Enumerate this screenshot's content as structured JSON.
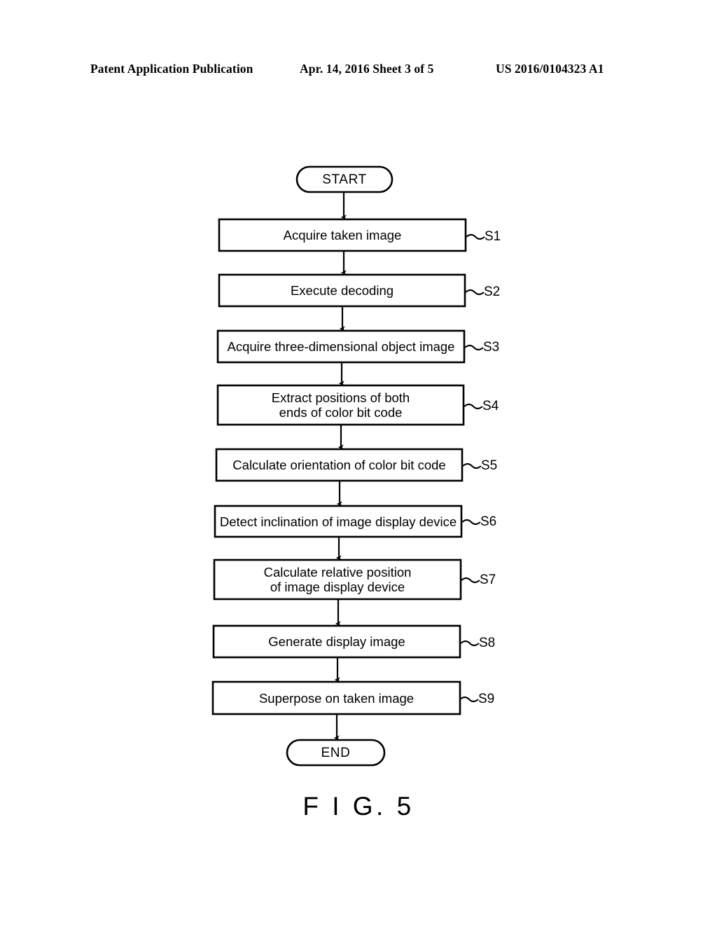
{
  "header": {
    "publication": "Patent Application Publication",
    "date_sheet": "Apr. 14, 2016  Sheet 3 of 5",
    "document_number": "US 2016/0104323 A1"
  },
  "figure": {
    "caption": "F I G. 5"
  },
  "flowchart": {
    "start_label": "START",
    "end_label": "END",
    "steps": [
      {
        "id": "S1",
        "text": "Acquire taken image"
      },
      {
        "id": "S2",
        "text": "Execute decoding"
      },
      {
        "id": "S3",
        "text": "Acquire three-dimensional object image"
      },
      {
        "id": "S4",
        "text": "Extract positions of both\nends of color bit code"
      },
      {
        "id": "S5",
        "text": "Calculate orientation of color bit code"
      },
      {
        "id": "S6",
        "text": "Detect inclination of image display device"
      },
      {
        "id": "S7",
        "text": "Calculate relative position\nof image display device"
      },
      {
        "id": "S8",
        "text": "Generate display image"
      },
      {
        "id": "S9",
        "text": "Superpose on taken image"
      }
    ]
  },
  "colors": {
    "ink": "#000000",
    "page": "#ffffff"
  }
}
